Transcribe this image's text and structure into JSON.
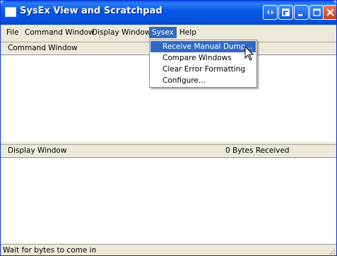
{
  "window": {
    "title": "SysEx View and Scratchpad"
  },
  "title_buttons": [
    {
      "name": "expand-icon"
    },
    {
      "name": "restore-icon"
    },
    {
      "name": "minimize-icon"
    },
    {
      "name": "maximize-icon"
    },
    {
      "name": "close-icon"
    }
  ],
  "menubar": {
    "file": "File",
    "command_window": "Command Window",
    "display_window": "Display Window",
    "sysex": "Sysex",
    "help": "Help"
  },
  "sysex_menu": {
    "items": [
      "Receive Manual Dump...",
      "Compare Windows",
      "Clear Error Formatting",
      "Configure..."
    ],
    "highlighted_index": 0
  },
  "command_panel": {
    "label": "Command Window"
  },
  "display_panel": {
    "label": "Display Window",
    "status": "0  Bytes Received"
  },
  "status_bar": {
    "text": "Wait for bytes to come in"
  },
  "colors": {
    "titlebar": "#0A5BE8",
    "highlight": "#316AC5",
    "close_button": "#D9542F",
    "face": "#ECE9D8"
  }
}
